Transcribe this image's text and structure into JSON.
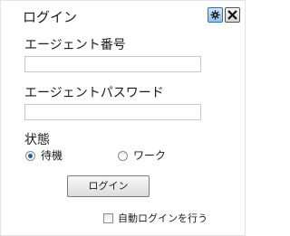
{
  "window": {
    "title": "ログイン",
    "settings_icon": "gear-icon",
    "close_icon": "close-icon"
  },
  "form": {
    "agent_number_label": "エージェント番号",
    "agent_number_value": "",
    "agent_password_label": "エージェントパスワード",
    "agent_password_value": ""
  },
  "status": {
    "label": "状態",
    "options": [
      {
        "label": "待機",
        "selected": true
      },
      {
        "label": "ワーク",
        "selected": false
      }
    ]
  },
  "login_button_label": "ログイン",
  "auto_login": {
    "label": "自動ログインを行う",
    "checked": false
  },
  "colors": {
    "accent": "#1f5fa8",
    "settings_button": "#8ec2f5"
  }
}
